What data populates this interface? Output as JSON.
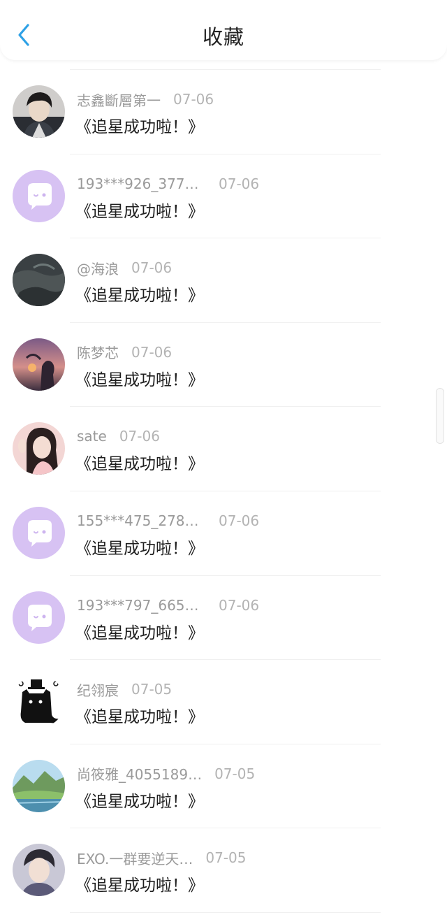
{
  "header": {
    "title": "收藏",
    "back_icon": "chevron-left-icon",
    "accent": "#2ea1e6"
  },
  "items": [
    {
      "name": "志鑫斷層第一",
      "date": "07-06",
      "message": "《追星成功啦！》",
      "avatar": "photo-boy"
    },
    {
      "name": "193***926_3774…",
      "date": "07-06",
      "message": "《追星成功啦！》",
      "avatar": "default-chat"
    },
    {
      "name": "@海浪",
      "date": "07-06",
      "message": "《追星成功啦！》",
      "avatar": "photo-rock"
    },
    {
      "name": "陈梦芯",
      "date": "07-06",
      "message": "《追星成功啦！》",
      "avatar": "photo-sunset"
    },
    {
      "name": "sate",
      "date": "07-06",
      "message": "《追星成功啦！》",
      "avatar": "photo-girl"
    },
    {
      "name": "155***475_2789…",
      "date": "07-06",
      "message": "《追星成功啦！》",
      "avatar": "default-chat"
    },
    {
      "name": "193***797_6658…",
      "date": "07-06",
      "message": "《追星成功啦！》",
      "avatar": "default-chat"
    },
    {
      "name": "纪翎宸",
      "date": "07-05",
      "message": "《追星成功啦！》",
      "avatar": "cartoon-cat"
    },
    {
      "name": "尚筱雅_4055189…",
      "date": "07-05",
      "message": "《追星成功啦！》",
      "avatar": "photo-landscape"
    },
    {
      "name": "EXO.一群要逆天…",
      "date": "07-05",
      "message": "《追星成功啦！》",
      "avatar": "photo-boy2"
    }
  ],
  "colors": {
    "default_avatar": "#d7c2f3",
    "text_primary": "#1e1e1e",
    "text_secondary": "#9a9a9a"
  }
}
